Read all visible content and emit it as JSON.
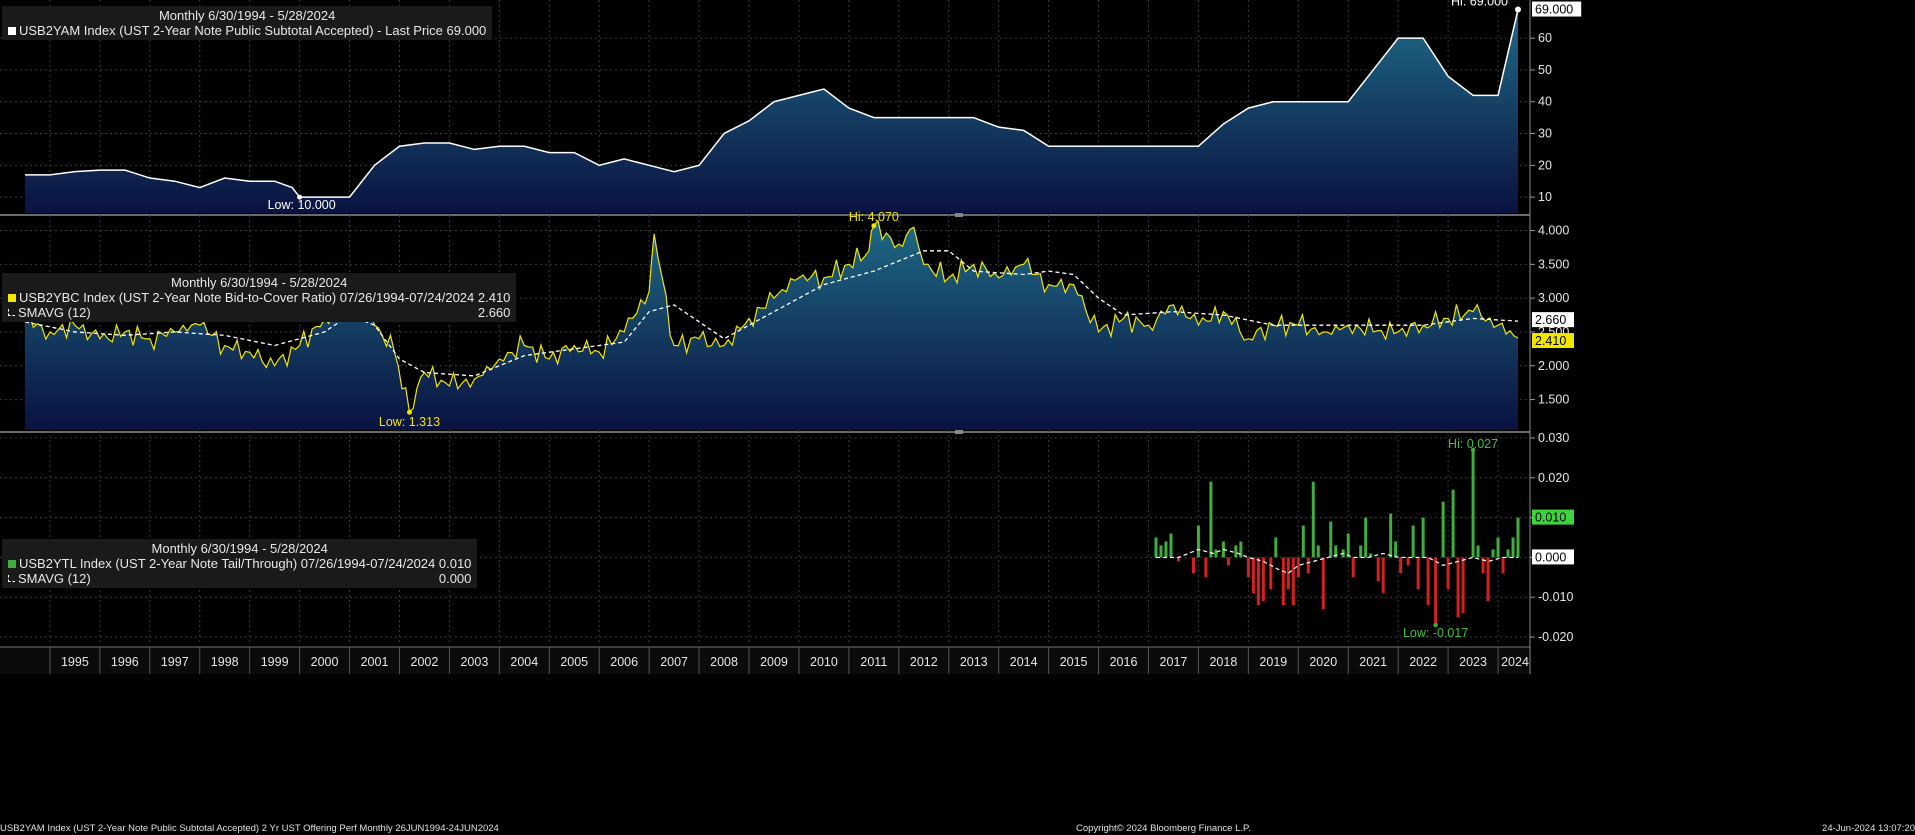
{
  "colors": {
    "background": "#000000",
    "grid": "#3a3a3a",
    "line_white": "#ffffff",
    "line_yellow": "#f2e600",
    "pos_bar": "#3fae3f",
    "neg_bar": "#d42020",
    "area_top": "#1f6a86",
    "area_bottom": "#0a1240"
  },
  "x_axis": {
    "years": [
      "1995",
      "1996",
      "1997",
      "1998",
      "1999",
      "2000",
      "2001",
      "2002",
      "2003",
      "2004",
      "2005",
      "2006",
      "2007",
      "2008",
      "2009",
      "2010",
      "2011",
      "2012",
      "2013",
      "2014",
      "2015",
      "2016",
      "2017",
      "2018",
      "2019",
      "2020",
      "2021",
      "2022",
      "2023",
      "2024"
    ]
  },
  "panel1": {
    "title": "Monthly 6/30/1994 - 5/28/2024",
    "series_label": "USB2YAM Index (UST 2-Year Note Public Subtotal Accepted) - Last Price 69.000",
    "hi_label": "Hi: 69.000",
    "low_label": "Low: 10.000",
    "last_label": "69.000",
    "y_ticks": [
      "10",
      "20",
      "30",
      "40",
      "50",
      "60"
    ]
  },
  "panel2": {
    "title": "Monthly 6/30/1994 - 5/28/2024",
    "series_label": "USB2YBC Index (UST 2-Year Note Bid-to-Cover Ratio) 07/26/1994-07/24/2024 2.410",
    "sma_label": "SMAVG (12)",
    "sma_value": "2.660",
    "hi_label": "Hi: 4.070",
    "low_label": "Low: 1.313",
    "last_label": "2.410",
    "sma_last_label": "2.660",
    "y_ticks": [
      "1.500",
      "2.000",
      "2.500",
      "3.000",
      "3.500",
      "4.000"
    ]
  },
  "panel3": {
    "title": "Monthly 6/30/1994 - 5/28/2024",
    "series_label": "USB2YTL Index (UST 2-Year Note Tail/Through) 07/26/1994-07/24/2024 0.010",
    "sma_label": "SMAVG (12)",
    "sma_value": "0.000",
    "hi_label": "Hi: 0.027",
    "low_label": "Low: -0.017",
    "last_label": "0.010",
    "sma_last_label": "0.000",
    "y_ticks": [
      "-0.020",
      "-0.010",
      "0.000",
      "0.010",
      "0.020",
      "0.030"
    ]
  },
  "footer": {
    "left": "USB2YAM Index (UST 2-Year Note Public Subtotal Accepted) 2 Yr UST Offering Perf  Monthly 26JUN1994-24JUN2024",
    "center": "Copyright© 2024 Bloomberg Finance L.P.",
    "right": "24-Jun-2024 13:07:20"
  },
  "chart_data": [
    {
      "type": "area",
      "title": "Monthly 6/30/1994 - 5/28/2024",
      "series": [
        {
          "name": "USB2YAM Index (UST 2-Year Note Public Subtotal Accepted)",
          "x": [
            1994.5,
            1995.0,
            1995.5,
            1996.0,
            1996.5,
            1997.0,
            1997.5,
            1998.0,
            1998.5,
            1999.0,
            1999.5,
            1999.85,
            2000.0,
            2000.5,
            2001.0,
            2001.5,
            2002.0,
            2002.5,
            2003.0,
            2003.5,
            2004.0,
            2004.5,
            2005.0,
            2005.5,
            2006.0,
            2006.5,
            2007.0,
            2007.5,
            2008.0,
            2008.5,
            2009.0,
            2009.5,
            2010.0,
            2010.5,
            2011.0,
            2011.5,
            2012.0,
            2012.5,
            2013.0,
            2013.5,
            2014.0,
            2014.5,
            2015.0,
            2015.5,
            2016.0,
            2016.5,
            2017.0,
            2017.5,
            2018.0,
            2018.5,
            2019.0,
            2019.5,
            2020.0,
            2020.5,
            2021.0,
            2021.5,
            2022.0,
            2022.5,
            2023.0,
            2023.5,
            2024.0,
            2024.4
          ],
          "values": [
            17,
            17,
            18,
            18.5,
            18.5,
            16,
            15,
            13,
            16,
            15,
            15,
            13,
            10,
            10,
            10,
            20,
            26,
            27,
            27,
            25,
            26,
            26,
            24,
            24,
            20,
            22,
            20,
            18,
            20,
            30,
            34,
            40,
            42,
            44,
            38,
            35,
            35,
            35,
            35,
            35,
            32,
            31,
            26,
            26,
            26,
            26,
            26,
            26,
            26,
            33,
            38,
            40,
            40,
            40,
            40,
            50,
            60,
            60,
            48,
            42,
            42,
            69
          ]
        }
      ],
      "ylim": [
        5,
        72
      ]
    },
    {
      "type": "line",
      "title": "Monthly 6/30/1994 - 5/28/2024",
      "series": [
        {
          "name": "USB2YBC Index (UST 2-Year Note Bid-to-Cover Ratio)",
          "x": [
            1994.5,
            1995.0,
            1995.5,
            1996.0,
            1996.5,
            1997.0,
            1997.5,
            1998.0,
            1998.5,
            1999.0,
            1999.5,
            2000.0,
            2000.5,
            2001.0,
            2001.5,
            2001.9,
            2002.2,
            2002.5,
            2003.0,
            2003.5,
            2004.0,
            2004.5,
            2005.0,
            2005.5,
            2006.0,
            2006.5,
            2007.0,
            2007.1,
            2007.5,
            2008.0,
            2008.5,
            2009.0,
            2009.5,
            2010.0,
            2010.5,
            2011.0,
            2011.4,
            2011.5,
            2012.0,
            2012.3,
            2012.5,
            2013.0,
            2013.5,
            2014.0,
            2014.5,
            2015.0,
            2015.5,
            2016.0,
            2016.5,
            2017.0,
            2017.5,
            2018.0,
            2018.5,
            2019.0,
            2019.5,
            2020.0,
            2020.5,
            2021.0,
            2021.5,
            2022.0,
            2022.5,
            2023.0,
            2023.5,
            2024.0,
            2024.4
          ],
          "values": [
            2.7,
            2.5,
            2.6,
            2.4,
            2.5,
            2.4,
            2.5,
            2.6,
            2.3,
            2.2,
            2.0,
            2.3,
            2.7,
            2.9,
            2.6,
            2.2,
            1.313,
            1.9,
            1.7,
            1.8,
            2.1,
            2.3,
            2.1,
            2.3,
            2.2,
            2.5,
            3.1,
            3.95,
            2.3,
            2.4,
            2.3,
            2.7,
            3.0,
            3.3,
            3.3,
            3.5,
            3.7,
            4.07,
            3.8,
            4.05,
            3.5,
            3.3,
            3.5,
            3.3,
            3.5,
            3.2,
            3.2,
            2.5,
            2.7,
            2.6,
            2.9,
            2.6,
            2.8,
            2.4,
            2.6,
            2.6,
            2.5,
            2.6,
            2.5,
            2.5,
            2.6,
            2.7,
            2.8,
            2.6,
            2.41
          ]
        },
        {
          "name": "SMAVG (12)",
          "x": [
            1994.5,
            1995.5,
            1996.5,
            1997.5,
            1998.5,
            1999.5,
            2000.5,
            2001.0,
            2001.5,
            2002.0,
            2002.5,
            2003.5,
            2004.5,
            2005.5,
            2006.5,
            2007.0,
            2007.5,
            2008.0,
            2008.5,
            2009.5,
            2010.5,
            2011.5,
            2012.5,
            2013.0,
            2013.5,
            2014.5,
            2015.0,
            2015.5,
            2016.0,
            2016.5,
            2017.5,
            2018.5,
            2019.5,
            2020.5,
            2021.5,
            2022.5,
            2023.5,
            2024.4
          ],
          "values": [
            2.65,
            2.5,
            2.45,
            2.5,
            2.45,
            2.3,
            2.5,
            2.75,
            2.6,
            2.1,
            1.9,
            1.85,
            2.15,
            2.25,
            2.35,
            2.8,
            2.9,
            2.65,
            2.4,
            2.8,
            3.2,
            3.4,
            3.7,
            3.7,
            3.4,
            3.35,
            3.4,
            3.35,
            3.0,
            2.75,
            2.8,
            2.75,
            2.6,
            2.6,
            2.6,
            2.6,
            2.7,
            2.66
          ]
        }
      ],
      "ylim": [
        1.05,
        4.2
      ]
    },
    {
      "type": "bar",
      "title": "Monthly 6/30/1994 - 5/28/2024",
      "series": [
        {
          "name": "USB2YTL Index (UST 2-Year Note Tail/Through)",
          "x": [
            2017.15,
            2017.25,
            2017.35,
            2017.45,
            2017.6,
            2017.9,
            2018.0,
            2018.15,
            2018.25,
            2018.35,
            2018.5,
            2018.6,
            2018.75,
            2018.85,
            2019.0,
            2019.1,
            2019.2,
            2019.3,
            2019.45,
            2019.55,
            2019.7,
            2019.8,
            2019.9,
            2020.0,
            2020.1,
            2020.2,
            2020.3,
            2020.4,
            2020.5,
            2020.65,
            2020.75,
            2020.9,
            2021.0,
            2021.1,
            2021.25,
            2021.35,
            2021.45,
            2021.6,
            2021.7,
            2021.85,
            2021.95,
            2022.05,
            2022.2,
            2022.3,
            2022.4,
            2022.5,
            2022.6,
            2022.75,
            2022.9,
            2023.0,
            2023.1,
            2023.2,
            2023.3,
            2023.5,
            2023.6,
            2023.7,
            2023.8,
            2023.9,
            2024.0,
            2024.1,
            2024.2,
            2024.3,
            2024.4
          ],
          "values": [
            0.005,
            0.003,
            0.004,
            0.006,
            -0.001,
            -0.004,
            0.008,
            -0.005,
            0.019,
            0.002,
            0.004,
            -0.002,
            0.003,
            0.004,
            -0.005,
            -0.009,
            -0.012,
            -0.011,
            -0.008,
            0.005,
            -0.012,
            -0.008,
            -0.012,
            -0.005,
            0.008,
            -0.004,
            0.019,
            0.003,
            -0.013,
            0.009,
            0.003,
            0.002,
            0.006,
            -0.005,
            0.003,
            0.01,
            0.001,
            -0.006,
            -0.009,
            0.011,
            0.004,
            -0.004,
            -0.002,
            0.008,
            -0.008,
            0.01,
            -0.012,
            -0.017,
            0.014,
            -0.008,
            0.017,
            -0.015,
            -0.014,
            0.027,
            0.003,
            -0.004,
            -0.011,
            0.002,
            0.005,
            -0.004,
            0.002,
            0.005,
            0.01
          ]
        },
        {
          "name": "SMAVG (12)",
          "x": [
            2017.15,
            2017.6,
            2018.0,
            2018.3,
            2018.5,
            2018.8,
            2019.0,
            2019.3,
            2019.6,
            2019.8,
            2020.0,
            2020.3,
            2020.6,
            2020.9,
            2021.1,
            2021.4,
            2021.7,
            2022.0,
            2022.3,
            2022.6,
            2022.9,
            2023.2,
            2023.5,
            2023.8,
            2024.1,
            2024.4
          ],
          "values": [
            0.0,
            0.0,
            0.002,
            0.001,
            0.002,
            0.001,
            0.0,
            -0.001,
            -0.003,
            -0.004,
            -0.002,
            -0.001,
            0.0,
            0.001,
            0.0,
            0.0,
            0.001,
            0.0,
            0.0,
            0.0,
            -0.002,
            -0.001,
            0.0,
            -0.001,
            0.0,
            0.0
          ]
        }
      ],
      "ylim": [
        -0.022,
        0.031
      ]
    }
  ]
}
